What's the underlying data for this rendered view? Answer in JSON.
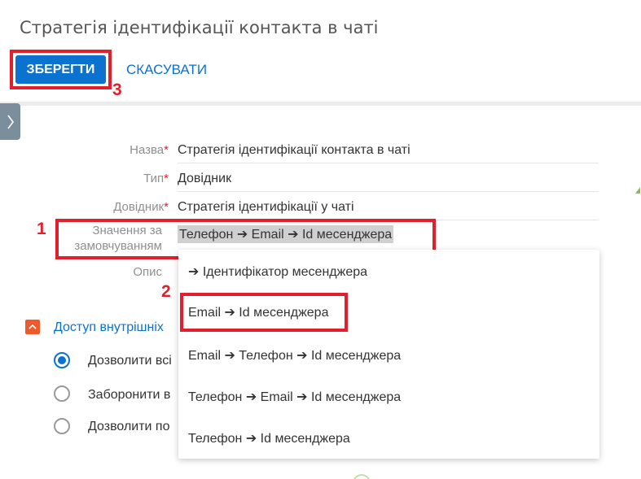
{
  "page": {
    "title": "Стратегія ідентифікації контакта в чаті"
  },
  "toolbar": {
    "save_label": "ЗБЕРЕГТИ",
    "cancel_label": "СКАСУВАТИ"
  },
  "markers": {
    "one": "1",
    "two": "2",
    "three": "3"
  },
  "form": {
    "name": {
      "label": "Назва",
      "required": "*",
      "value": "Стратегія ідентифікації контакта в чаті"
    },
    "type": {
      "label": "Тип",
      "required": "*",
      "value": "Довідник"
    },
    "lookup": {
      "label": "Довідник",
      "required": "*",
      "value": "Стратегія ідентифікації у чаті"
    },
    "default_value": {
      "label_line1": "Значення за",
      "label_line2": "замовчуванням",
      "value": "Телефон ➔ Email ➔ Id месенджера"
    },
    "description": {
      "label": "Опис"
    }
  },
  "dropdown": {
    "options": [
      "➔ Ідентифікатор месенджера",
      "Email ➔ Id месенджера",
      "Email ➔ Телефон ➔ Id месенджера",
      "Телефон ➔ Email ➔ Id месенджера",
      "Телефон ➔ Id месенджера"
    ]
  },
  "access": {
    "title": "Доступ внутрішніх",
    "options": [
      {
        "label": "Дозволити всі",
        "selected": true
      },
      {
        "label": "Заборонити в",
        "selected": false
      },
      {
        "label": "Дозволити по",
        "selected": false
      }
    ]
  },
  "colors": {
    "accent": "#0c72cf",
    "highlight": "#e0202c",
    "section_icon": "#f05a2a"
  },
  "icons": {
    "sidebar_toggle": "chevron-right-icon",
    "section_toggle": "chevron-up-icon"
  }
}
